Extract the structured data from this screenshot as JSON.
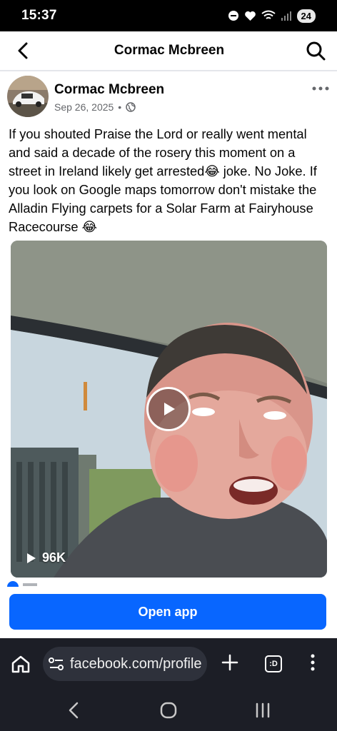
{
  "status_bar": {
    "time": "15:37",
    "battery": "24"
  },
  "header": {
    "title": "Cormac Mcbreen",
    "back_icon": "back-arrow-icon",
    "search_icon": "search-icon"
  },
  "post": {
    "author": "Cormac Mcbreen",
    "date": "Sep 26, 2025",
    "separator": "•",
    "privacy_icon": "globe-icon",
    "text": "If you shouted Praise the Lord or really went mental and said a decade of the rosery this moment on a street in Ireland likely get arrested😂 joke. No Joke. If you look on Google maps tomorrow don't mistake the Alladin Flying carpets for a Solar Farm at Fairyhouse Racecourse 😂",
    "video": {
      "views": "96K"
    }
  },
  "open_app": {
    "label": "Open app"
  },
  "browser": {
    "url": "facebook.com/profile",
    "tab_label": ":D"
  },
  "colors": {
    "accent": "#0866ff",
    "bar": "#1c1e26"
  }
}
